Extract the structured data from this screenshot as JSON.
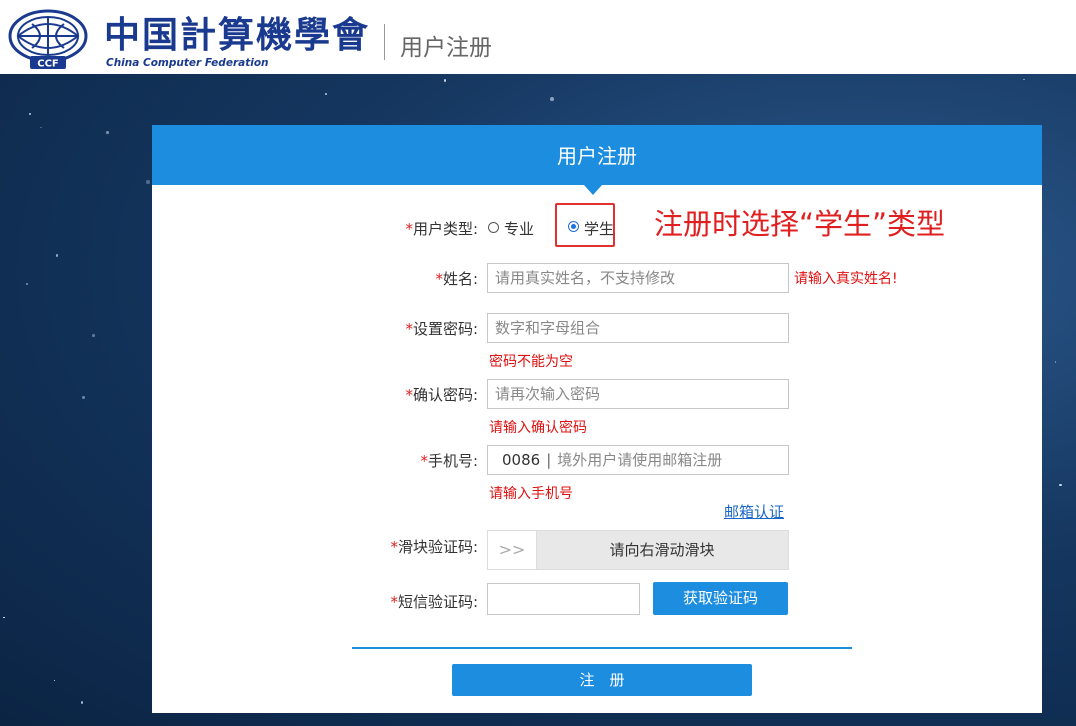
{
  "header": {
    "logo_text_cn": "中国計算機學會",
    "logo_text_en": "China Computer Federation",
    "emblem_text": "CCF",
    "page_title": "用户注册"
  },
  "card": {
    "title": "用户注册"
  },
  "form": {
    "required_mark": "*",
    "user_type": {
      "label": "用户类型:",
      "options": [
        {
          "label": "专业",
          "selected": false
        },
        {
          "label": "学生",
          "selected": true
        }
      ]
    },
    "annotation": "注册时选择“学生”类型",
    "name": {
      "label": "姓名:",
      "placeholder": "请用真实姓名，不支持修改",
      "error": "请输入真实姓名!"
    },
    "password": {
      "label": "设置密码:",
      "placeholder": "数字和字母组合",
      "error": "密码不能为空"
    },
    "confirm_password": {
      "label": "确认密码:",
      "placeholder": "请再次输入密码",
      "error": "请输入确认密码"
    },
    "phone": {
      "label": "手机号:",
      "prefix": "0086",
      "separator": "|",
      "placeholder": "境外用户请使用邮箱注册",
      "error": "请输入手机号",
      "email_link": "邮箱认证"
    },
    "slider_captcha": {
      "label": "滑块验证码:",
      "handle_glyph": ">>",
      "text": "请向右滑动滑块"
    },
    "sms_code": {
      "label": "短信验证码:",
      "value": "",
      "button": "获取验证码"
    },
    "submit": "注　册"
  },
  "colors": {
    "brand_blue": "#1d8de0",
    "error_red": "#e01010",
    "logo_blue": "#1a3a8f"
  }
}
